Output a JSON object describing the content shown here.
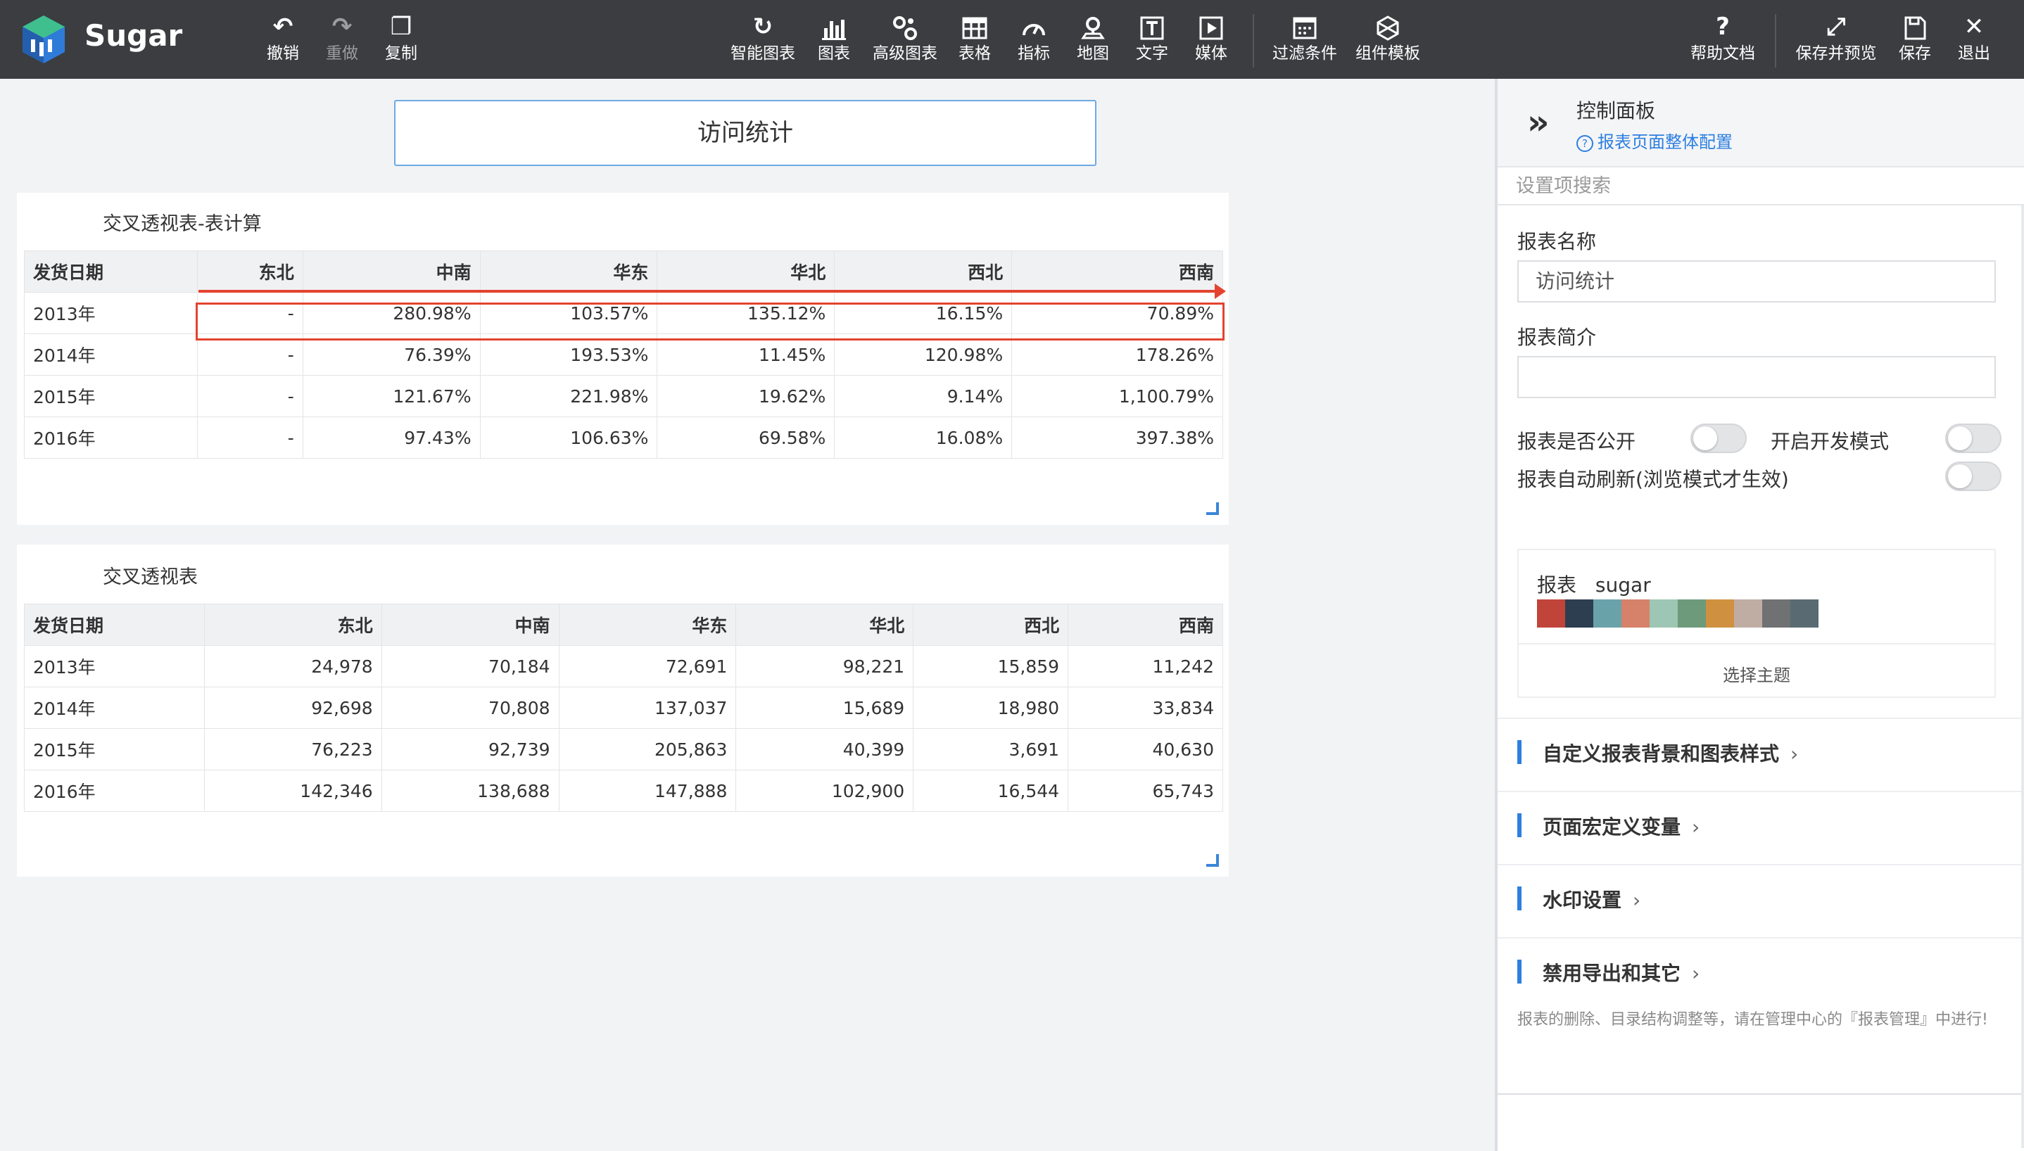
{
  "app": {
    "name": "Sugar"
  },
  "toolbar": {
    "left": [
      {
        "label": "撤销",
        "icon": "undo-icon"
      },
      {
        "label": "重做",
        "icon": "redo-icon"
      },
      {
        "label": "复制",
        "icon": "copy-icon"
      }
    ],
    "center": [
      {
        "label": "智能图表",
        "icon": "smart-chart-icon"
      },
      {
        "label": "图表",
        "icon": "bar-chart-icon"
      },
      {
        "label": "高级图表",
        "icon": "advanced-chart-icon"
      },
      {
        "label": "表格",
        "icon": "table-icon"
      },
      {
        "label": "指标",
        "icon": "gauge-icon"
      },
      {
        "label": "地图",
        "icon": "map-pin-icon"
      },
      {
        "label": "文字",
        "icon": "text-icon"
      },
      {
        "label": "媒体",
        "icon": "media-icon"
      },
      {
        "label": "过滤条件",
        "icon": "filter-icon"
      },
      {
        "label": "组件模板",
        "icon": "template-icon"
      }
    ],
    "right": [
      {
        "label": "帮助文档",
        "icon": "help-icon"
      },
      {
        "label": "保存并预览",
        "icon": "expand-icon"
      },
      {
        "label": "保存",
        "icon": "save-icon"
      },
      {
        "label": "退出",
        "icon": "close-icon"
      }
    ]
  },
  "report": {
    "title": "访问统计"
  },
  "table1": {
    "title": "交叉透视表-表计算",
    "headers": [
      "发货日期",
      "东北",
      "中南",
      "华东",
      "华北",
      "西北",
      "西南"
    ],
    "rows": [
      [
        "2013年",
        "-",
        "280.98%",
        "103.57%",
        "135.12%",
        "16.15%",
        "70.89%"
      ],
      [
        "2014年",
        "-",
        "76.39%",
        "193.53%",
        "11.45%",
        "120.98%",
        "178.26%"
      ],
      [
        "2015年",
        "-",
        "121.67%",
        "221.98%",
        "19.62%",
        "9.14%",
        "1,100.79%"
      ],
      [
        "2016年",
        "-",
        "97.43%",
        "106.63%",
        "69.58%",
        "16.08%",
        "397.38%"
      ]
    ]
  },
  "table2": {
    "title": "交叉透视表",
    "headers": [
      "发货日期",
      "东北",
      "中南",
      "华东",
      "华北",
      "西北",
      "西南"
    ],
    "rows": [
      [
        "2013年",
        "24,978",
        "70,184",
        "72,691",
        "98,221",
        "15,859",
        "11,242"
      ],
      [
        "2014年",
        "92,698",
        "70,808",
        "137,037",
        "15,689",
        "18,980",
        "33,834"
      ],
      [
        "2015年",
        "76,223",
        "92,739",
        "205,863",
        "40,399",
        "3,691",
        "40,630"
      ],
      [
        "2016年",
        "142,346",
        "138,688",
        "147,888",
        "102,900",
        "16,544",
        "65,743"
      ]
    ]
  },
  "panel": {
    "title": "控制面板",
    "link": "报表页面整体配置",
    "search_placeholder": "设置项搜索",
    "name_label": "报表名称",
    "name_value": "访问统计",
    "desc_label": "报表简介",
    "desc_value": "",
    "public_label": "报表是否公开",
    "dev_label": "开启开发模式",
    "refresh_label": "报表自动刷新(浏览模式才生效)",
    "theme_label": "报表",
    "theme_name": "sugar",
    "theme_colors": [
      "#c0443a",
      "#2c3e50",
      "#6aa2aa",
      "#d6826a",
      "#9ec6b4",
      "#6e9a7c",
      "#cf913f",
      "#bfada4",
      "#6f7173",
      "#596a72"
    ],
    "theme_button": "选择主题",
    "sections": [
      "自定义报表背景和图表样式",
      "页面宏定义变量",
      "水印设置",
      "禁用导出和其它"
    ],
    "arrow": "›",
    "note": "报表的删除、目录结构调整等，请在管理中心的『报表管理』中进行!"
  }
}
